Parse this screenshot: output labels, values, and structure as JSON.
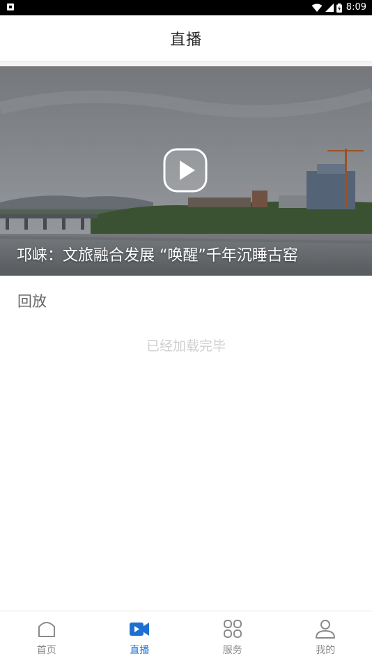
{
  "status_bar": {
    "time": "8:09",
    "icons": [
      "notification-a-icon",
      "wifi-icon",
      "cellular-signal-icon",
      "battery-icon"
    ]
  },
  "header": {
    "title": "直播"
  },
  "live_card": {
    "title": "邛崃：文旅融合发展 “唤醒”千年沉睡古窑",
    "play_icon": "play-icon"
  },
  "section": {
    "label": "回放"
  },
  "list_status": {
    "text": "已经加载完毕"
  },
  "tab_bar": {
    "active_color": "#1f6fd1",
    "inactive_color": "#8a8a8a",
    "tabs": [
      {
        "label": "首页",
        "icon": "home-icon",
        "active": false
      },
      {
        "label": "直播",
        "icon": "video-camera-icon",
        "active": true
      },
      {
        "label": "服务",
        "icon": "grid-icon",
        "active": false
      },
      {
        "label": "我的",
        "icon": "user-icon",
        "active": false
      }
    ]
  }
}
